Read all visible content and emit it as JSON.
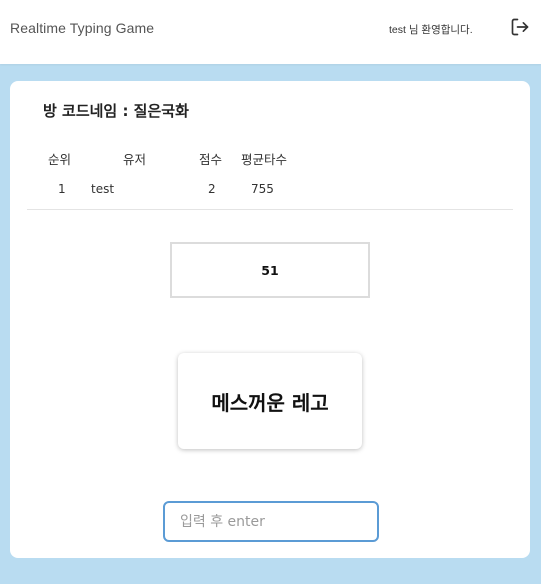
{
  "header": {
    "app_title": "Realtime Typing Game",
    "welcome_text": "test 님 환영합니다.",
    "logout_icon": "logout-icon"
  },
  "room": {
    "title": "방 코드네임 : 질은국화"
  },
  "ranking": {
    "columns": [
      "순위",
      "유저",
      "점수",
      "평균타수"
    ],
    "rows": [
      {
        "rank": "1",
        "user": "test",
        "score": "2",
        "avg_speed": "755"
      }
    ]
  },
  "timer": {
    "value": "51"
  },
  "word": {
    "text": "메스꺼운 레고"
  },
  "input": {
    "placeholder": "입력 후 enter",
    "value": ""
  },
  "colors": {
    "background": "#b9dcf1",
    "input_border": "#5b9bd5"
  }
}
